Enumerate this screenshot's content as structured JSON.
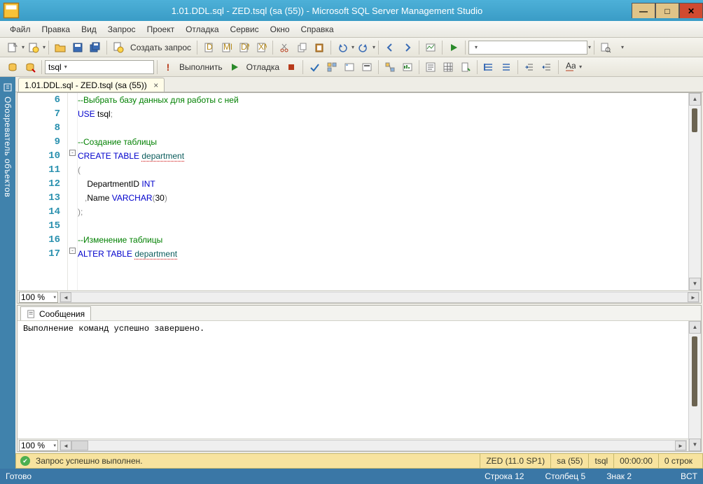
{
  "window": {
    "title": "1.01.DDL.sql - ZED.tsql (sa (55)) - Microsoft SQL Server Management Studio",
    "btn_min": "—",
    "btn_max": "□",
    "btn_close": "✕"
  },
  "menu": {
    "file": "Файл",
    "edit": "Правка",
    "view": "Вид",
    "query": "Запрос",
    "project": "Проект",
    "debug": "Отладка",
    "service": "Сервис",
    "window": "Окно",
    "help": "Справка"
  },
  "toolbar1": {
    "new_query": "Создать запрос"
  },
  "toolbar2": {
    "db_combo": "tsql",
    "execute": "Выполнить",
    "debug": "Отладка"
  },
  "sidebar": {
    "label": "Обозреватель объектов"
  },
  "doc_tab": {
    "label": "1.01.DDL.sql - ZED.tsql (sa (55))",
    "close": "×"
  },
  "editor": {
    "zoom": "100 %",
    "lines": [
      {
        "num": "6",
        "tokens": [
          [
            "c-comment",
            "--Выбрать базу данных для работы с ней"
          ]
        ]
      },
      {
        "num": "7",
        "tokens": [
          [
            "c-kw",
            "USE "
          ],
          [
            "c-ident",
            "tsql"
          ],
          [
            "c-paren",
            ";"
          ]
        ]
      },
      {
        "num": "8",
        "tokens": [
          [
            "",
            ""
          ]
        ]
      },
      {
        "num": "9",
        "tokens": [
          [
            "c-comment",
            "--Создание таблицы"
          ]
        ]
      },
      {
        "num": "10",
        "tokens": [
          [
            "c-kw",
            "CREATE TABLE "
          ],
          [
            "c-tbl",
            "department"
          ]
        ]
      },
      {
        "num": "11",
        "tokens": [
          [
            "c-paren",
            "("
          ]
        ]
      },
      {
        "num": "12",
        "tokens": [
          [
            "",
            "    "
          ],
          [
            "c-ident",
            "DepartmentID "
          ],
          [
            "c-type",
            "INT"
          ]
        ]
      },
      {
        "num": "13",
        "tokens": [
          [
            "",
            "   "
          ],
          [
            "c-paren",
            ","
          ],
          [
            "c-ident",
            "Name "
          ],
          [
            "c-type",
            "VARCHAR"
          ],
          [
            "c-paren",
            "("
          ],
          [
            "c-ident",
            "30"
          ],
          [
            "c-paren",
            ")"
          ]
        ]
      },
      {
        "num": "14",
        "tokens": [
          [
            "c-paren",
            ");"
          ]
        ]
      },
      {
        "num": "15",
        "tokens": [
          [
            "",
            ""
          ]
        ]
      },
      {
        "num": "16",
        "tokens": [
          [
            "c-comment",
            "--Изменение таблицы"
          ]
        ]
      },
      {
        "num": "17",
        "tokens": [
          [
            "c-kw",
            "ALTER TABLE "
          ],
          [
            "c-tbl",
            "department"
          ]
        ]
      }
    ]
  },
  "messages": {
    "tab": "Сообщения",
    "text": "Выполнение команд успешно завершено.",
    "zoom": "100 %"
  },
  "query_status": {
    "text": "Запрос успешно выполнен.",
    "server": "ZED (11.0 SP1)",
    "login": "sa (55)",
    "db": "tsql",
    "time": "00:00:00",
    "rows": "0 строк"
  },
  "statusbar": {
    "ready": "Готово",
    "line": "Строка 12",
    "col": "Столбец 5",
    "char": "Знак 2",
    "ins": "BCT"
  }
}
